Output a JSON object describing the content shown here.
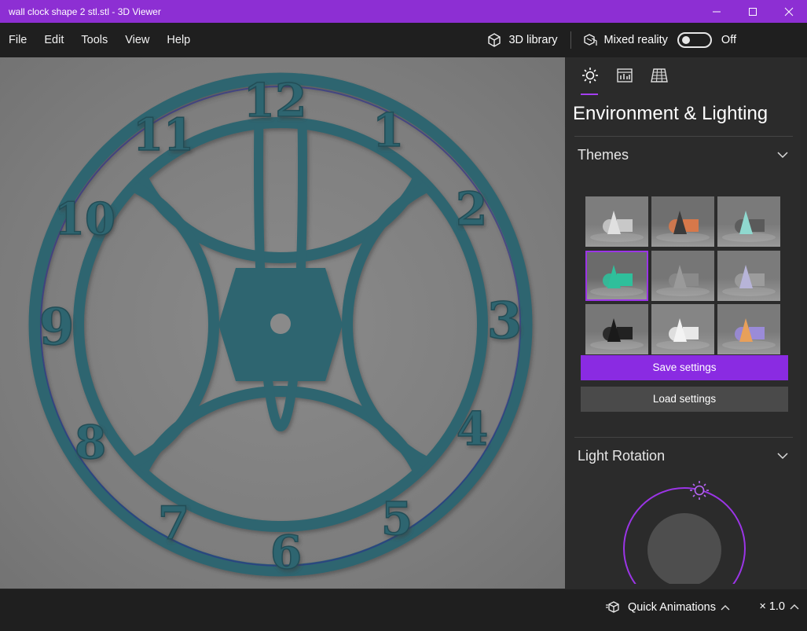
{
  "window": {
    "title": "wall clock shape 2 stl.stl - 3D Viewer",
    "controls": [
      "minimize-icon",
      "maximize-icon",
      "close-icon"
    ],
    "accent": "#8d2fd3"
  },
  "menu": {
    "items": [
      "File",
      "Edit",
      "Tools",
      "View",
      "Help"
    ],
    "library_label": "3D library",
    "mixed_reality_label": "Mixed reality",
    "mixed_reality_state": "Off"
  },
  "viewport": {
    "model": "wall clock",
    "numerals": [
      "12",
      "1",
      "2",
      "3",
      "4",
      "5",
      "6",
      "7",
      "8",
      "9",
      "10",
      "11"
    ],
    "model_color": "#2f6570"
  },
  "panel": {
    "tabs": [
      "sun-icon",
      "stats-icon",
      "grid-icon"
    ],
    "active_tab": "sun-icon",
    "heading": "Environment & Lighting",
    "themes": {
      "label": "Themes",
      "selected_index": 3,
      "swatches": [
        {
          "bg": "#7d7d7d",
          "a": "#e0e0e0",
          "b": "#c8c8c8"
        },
        {
          "bg": "#6f6f6f",
          "a": "#3b3b3b",
          "b": "#d7784a"
        },
        {
          "bg": "#7a7a7a",
          "a": "#8fd8cf",
          "b": "#5a5a5a"
        },
        {
          "bg": "#6b6b6b",
          "a": "#2fbf9b",
          "b": "#2fbf9b"
        },
        {
          "bg": "#767676",
          "a": "#9a9a9a",
          "b": "#8a8a8a"
        },
        {
          "bg": "#7b7b7b",
          "a": "#b7b4d8",
          "b": "#9c9c9c"
        },
        {
          "bg": "#777777",
          "a": "#1a1a1a",
          "b": "#222222"
        },
        {
          "bg": "#858585",
          "a": "#f3f3f3",
          "b": "#e8e8e8"
        },
        {
          "bg": "#7a7a7a",
          "a": "#e8a05a",
          "b": "#9a8bd8"
        }
      ]
    },
    "save_label": "Save settings",
    "load_label": "Load settings",
    "light_rotation_label": "Light Rotation"
  },
  "bottom": {
    "quick_animations_label": "Quick Animations",
    "speed_label": "× 1.0"
  }
}
